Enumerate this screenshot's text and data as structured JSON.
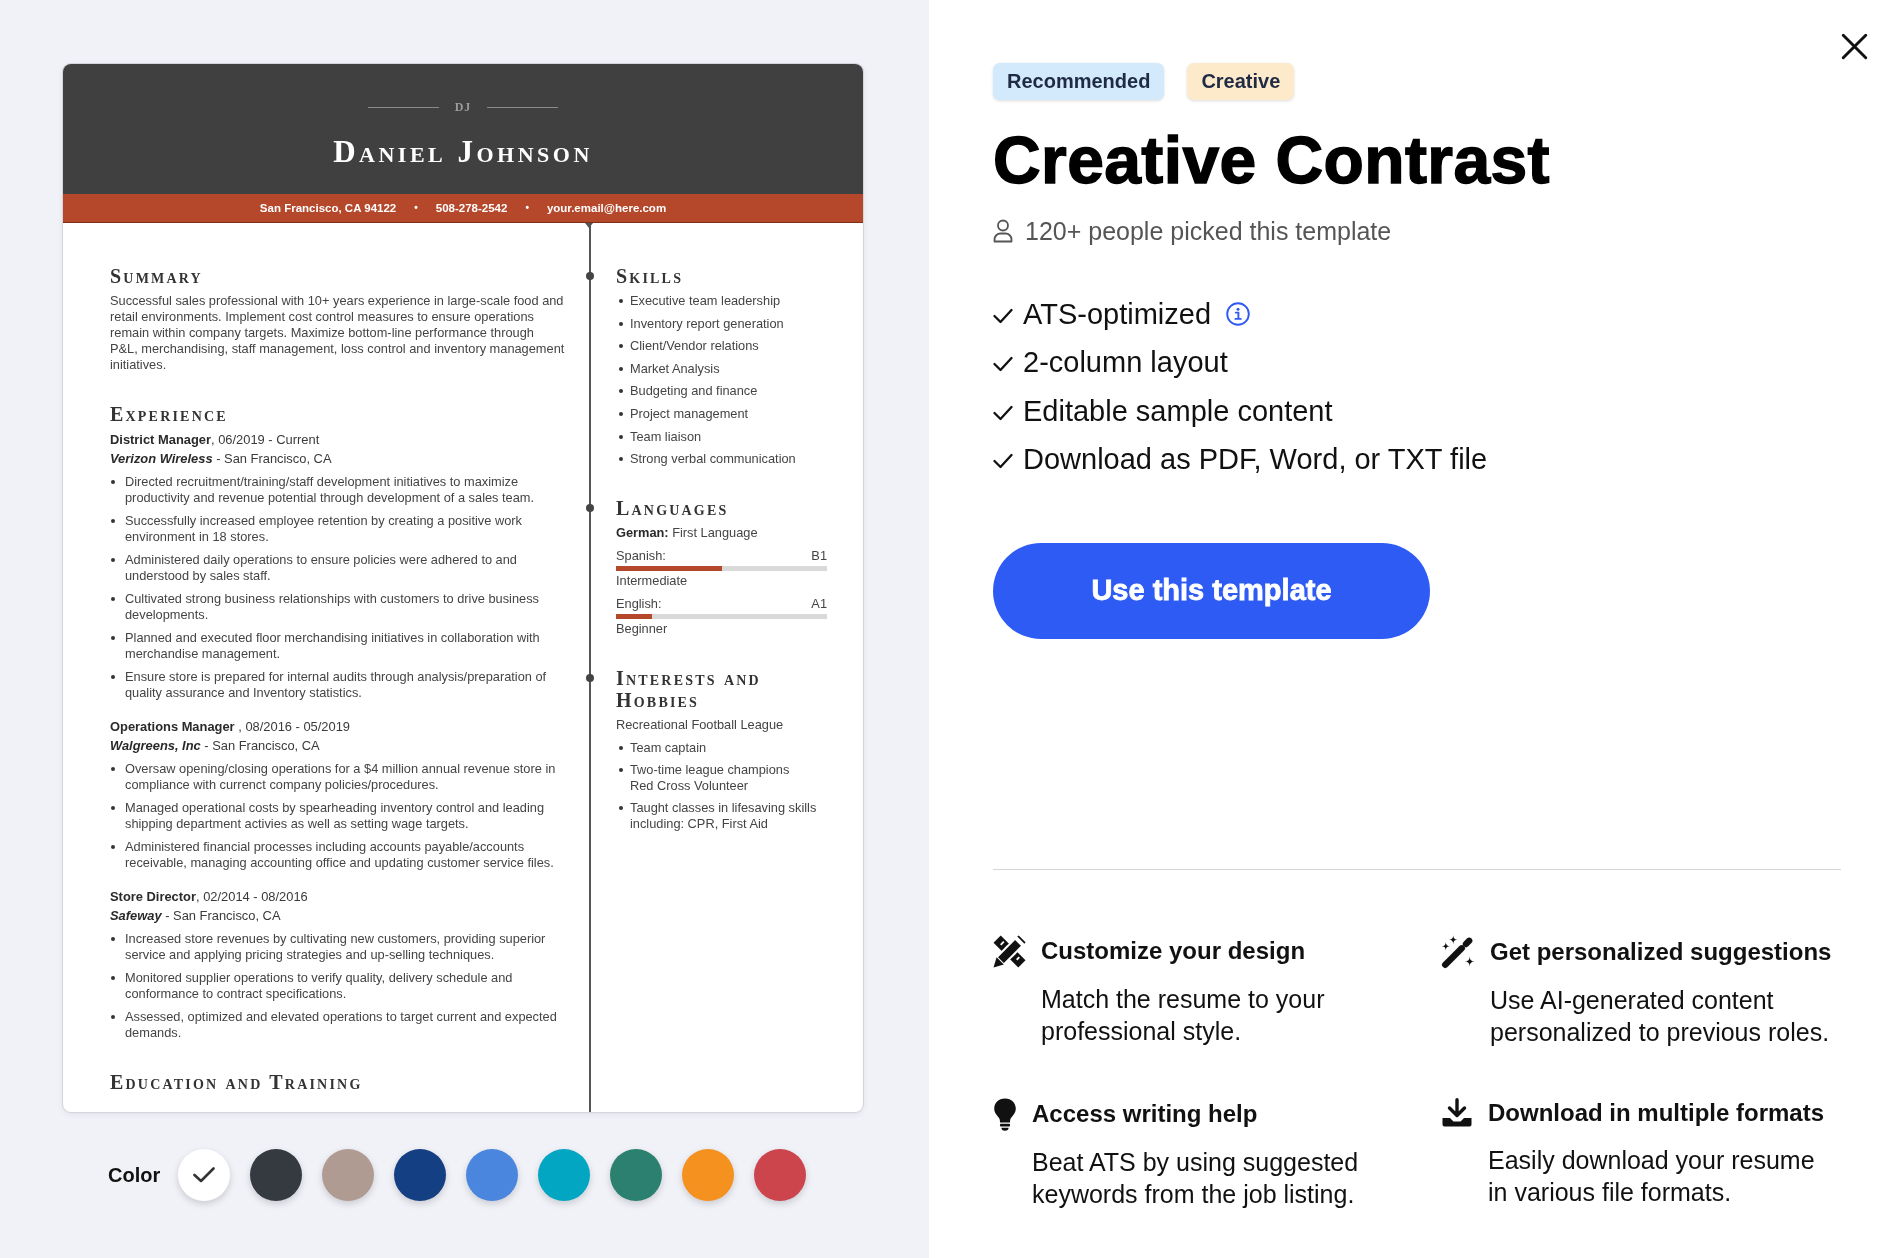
{
  "resume_preview": {
    "initials": "DJ",
    "name": "Daniel Johnson",
    "contact": [
      {
        "kind": "value",
        "text": "San Francisco, CA 94122"
      },
      {
        "kind": "separator",
        "text": "•"
      },
      {
        "kind": "value",
        "text": "508-278-2542"
      },
      {
        "kind": "separator",
        "text": "•"
      },
      {
        "kind": "value",
        "text": "your.email@here.com"
      }
    ],
    "summary": {
      "heading": "Summary",
      "text": "Successful sales professional with 10+ years experience in large-scale food and retail environments. Implement cost control measures to ensure operations remain within company targets. Maximize bottom-line performance through P&L, merchandising, staff management, loss control and inventory management initiatives."
    },
    "experience": {
      "heading": "Experience",
      "jobs": [
        {
          "title_line": "**District Manager**, 06/2019 - Current",
          "company_line": "*Verizon Wireless* - San Francisco, CA",
          "bullets": [
            "Directed recruitment/training/staff development initiatives to maximize productivity and revenue potential through development of a sales team.",
            "Successfully increased employee retention by creating a positive work environment in 18 stores.",
            "Administered daily operations to ensure policies were adhered to and understood by sales staff.",
            "Cultivated strong business relationships with customers to drive business developments.",
            "Planned and executed floor merchandising initiatives in collaboration with merchandise management.",
            "Ensure store is prepared for internal audits through analysis/preparation of quality assurance and Inventory statistics."
          ]
        },
        {
          "title_line": "**Operations Manager** , 08/2016 - 05/2019",
          "company_line": "*Walgreens, Inc* - San Francisco, CA",
          "bullets": [
            "Oversaw opening/closing operations for a $4 million annual revenue store in compliance with currenct company policies/procedures.",
            "Managed operational costs by spearheading inventory control and leading shipping department activies as well as setting wage targets.",
            "Administered financial processes including accounts payable/accounts receivable, managing accounting office and updating customer service files."
          ]
        },
        {
          "title_line": "**Store Director**, 02/2014 - 08/2016",
          "company_line": "*Safeway* - San Francisco, CA",
          "bullets": [
            "Increased store revenues by cultivating new customers, providing superior service and applying pricing strategies and up-selling techniques.",
            "Monitored supplier operations to verify quality, delivery schedule and conformance to contract specifications.",
            "Assessed, optimized and elevated operations to target current and expected demands."
          ]
        }
      ]
    },
    "education": {
      "heading": "Education and Training"
    },
    "skills": {
      "heading": "Skills",
      "items": [
        "Executive team leadership",
        "Inventory report generation",
        "Client/Vendor relations",
        "Market Analysis",
        "Budgeting and finance",
        "Project management",
        "Team liaison",
        "Strong verbal communication"
      ]
    },
    "languages": {
      "heading": "Languages",
      "items": [
        {
          "kind": "native",
          "text": "**German:** First Language"
        },
        {
          "kind": "rated",
          "name": "Spanish:",
          "code": "B1",
          "level": 0.5,
          "proficiency": "Intermediate"
        },
        {
          "kind": "rated",
          "name": "English:",
          "code": "A1",
          "level": 0.17,
          "proficiency": "Beginner"
        }
      ]
    },
    "interests": {
      "heading": "Interests and Hobbies",
      "intro": "Recreational Football League",
      "items": [
        "Team captain",
        "Two-time league champions\nRed Cross Volunteer",
        "Taught classes in lifesaving skills including: CPR, First Aid"
      ]
    }
  },
  "color_picker": {
    "label": "Color",
    "swatches": [
      {
        "color": "#ffffff",
        "selected": true
      },
      {
        "color": "#343a40",
        "selected": false
      },
      {
        "color": "#b09b93",
        "selected": false
      },
      {
        "color": "#143f82",
        "selected": false
      },
      {
        "color": "#4a86de",
        "selected": false
      },
      {
        "color": "#03a6c2",
        "selected": false
      },
      {
        "color": "#2c8070",
        "selected": false
      },
      {
        "color": "#f5911f",
        "selected": false
      },
      {
        "color": "#cc444c",
        "selected": false
      }
    ]
  },
  "template": {
    "tags": [
      {
        "label": "Recommended",
        "color": "#d2eafb"
      },
      {
        "label": "Creative",
        "color": "#fdeacb"
      }
    ],
    "title": "Creative Contrast",
    "popularity": "120+ people picked this template",
    "checklist": [
      {
        "text": "ATS-optimized",
        "info": true
      },
      {
        "text": "2-column layout",
        "info": false
      },
      {
        "text": "Editable sample content",
        "info": false
      },
      {
        "text": "Download as PDF, Word, or TXT file",
        "info": false
      }
    ],
    "button": "Use this template",
    "features": [
      {
        "title": "Customize your design",
        "text": "Match the resume to your professional style."
      },
      {
        "title": "Get personalized suggestions",
        "text": "Use AI-generated content personalized to previous roles."
      },
      {
        "title": "Access writing help",
        "text": "Beat ATS by using suggested keywords from the job listing."
      },
      {
        "title": "Download in multiple formats",
        "text": "Easily download your resume in various file formats."
      }
    ]
  }
}
